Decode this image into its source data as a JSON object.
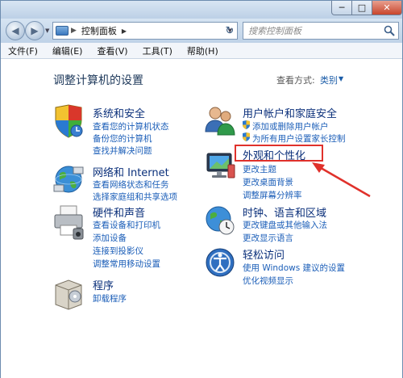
{
  "window": {
    "minimize_glyph": "─",
    "maximize_glyph": "□",
    "close_glyph": "✕"
  },
  "nav": {
    "back_glyph": "◀",
    "forward_glyph": "▶",
    "dropdown_glyph": "▼",
    "address_chevron": "▶",
    "address_text": "控制面板",
    "address_arrow": "▶",
    "refresh_glyph": "↻",
    "search_placeholder": "搜索控制面板"
  },
  "menu": [
    "文件(F)",
    "编辑(E)",
    "查看(V)",
    "工具(T)",
    "帮助(H)"
  ],
  "content": {
    "title": "调整计算机的设置",
    "view_by_label": "查看方式:",
    "view_by_value": "类别",
    "view_by_arrow": "▼"
  },
  "categories": {
    "system": {
      "title": "系统和安全",
      "links": [
        "查看您的计算机状态",
        "备份您的计算机",
        "查找并解决问题"
      ],
      "icon": "shield-flag-icon"
    },
    "network": {
      "title": "网络和 Internet",
      "links": [
        "查看网络状态和任务",
        "选择家庭组和共享选项"
      ],
      "icon": "globe-network-icon"
    },
    "hardware": {
      "title": "硬件和声音",
      "links": [
        "查看设备和打印机",
        "添加设备",
        "连接到投影仪",
        "调整常用移动设置"
      ],
      "icon": "printer-icon"
    },
    "programs": {
      "title": "程序",
      "links": [
        "卸载程序"
      ],
      "icon": "programs-box-icon"
    },
    "users": {
      "title": "用户帐户和家庭安全",
      "links": [
        "添加或删除用户帐户",
        "为所有用户设置家长控制"
      ],
      "icon": "users-icon"
    },
    "appearance": {
      "title": "外观和个性化",
      "links": [
        "更改主题",
        "更改桌面背景",
        "调整屏幕分辨率"
      ],
      "icon": "monitor-icon"
    },
    "clock": {
      "title": "时钟、语言和区域",
      "links": [
        "更改键盘或其他输入法",
        "更改显示语言"
      ],
      "icon": "clock-globe-icon"
    },
    "access": {
      "title": "轻松访问",
      "links": [
        "使用 Windows 建议的设置",
        "优化视频显示"
      ],
      "icon": "ease-of-access-icon"
    }
  },
  "colors": {
    "link": "#1b5eb8",
    "category_title": "#0a2f7a",
    "highlight": "#e0312b"
  }
}
